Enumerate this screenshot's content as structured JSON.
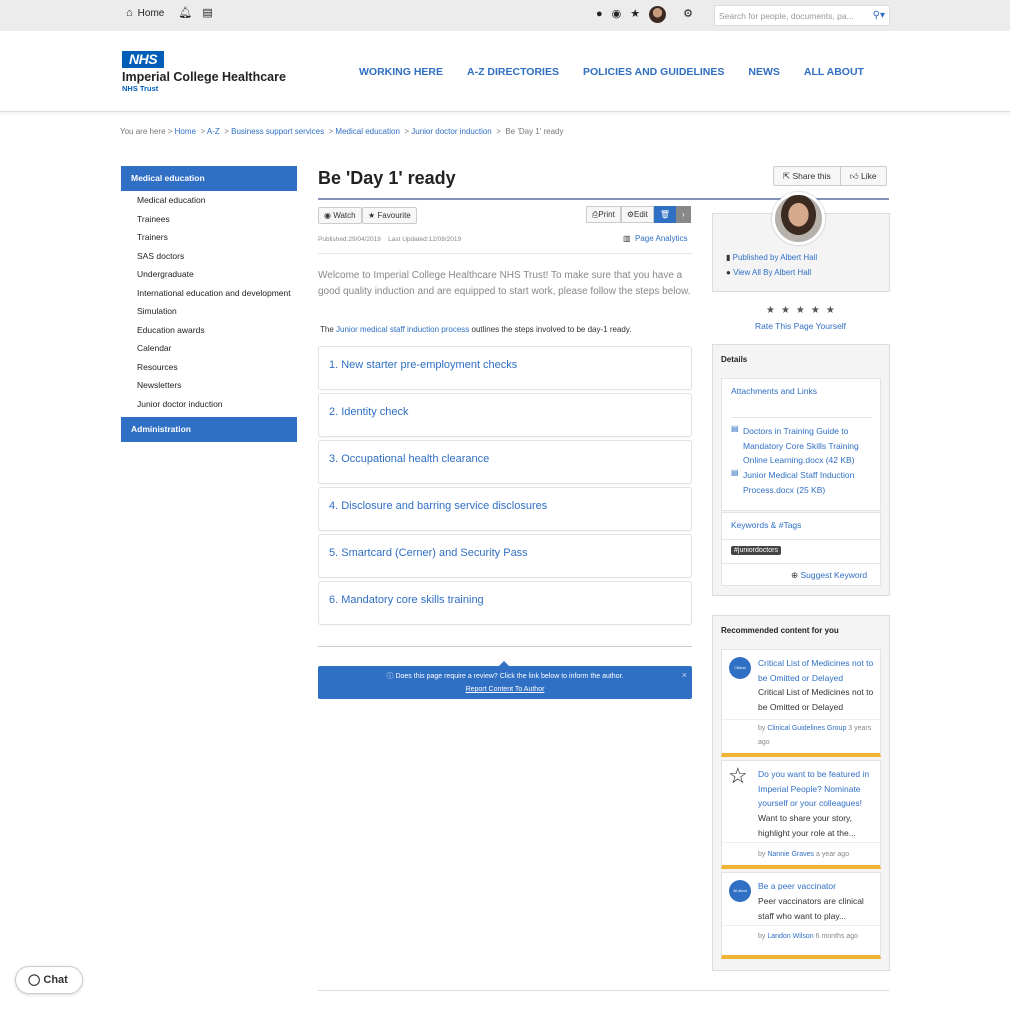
{
  "topbar": {
    "home_label": "Home",
    "search_placeholder": "Search for people, documents, pa...",
    "icons": [
      "home-icon",
      "bell-icon",
      "document-icon",
      "alert-icon",
      "eye-icon",
      "star-icon",
      "avatar",
      "gear-icon",
      "search-icon"
    ]
  },
  "header": {
    "logo": "NHS",
    "org_name": "Imperial College Healthcare",
    "trust": "NHS Trust",
    "nav": [
      "WORKING HERE",
      "A-Z DIRECTORIES",
      "POLICIES AND GUIDELINES",
      "NEWS",
      "ALL ABOUT"
    ]
  },
  "breadcrumb": {
    "prefix": "You are here >",
    "items": [
      "Home",
      "A-Z",
      "Business support services",
      "Medical education",
      "Junior doctor induction"
    ],
    "current": "Be 'Day 1' ready"
  },
  "sidebar": {
    "heading": "Medical education",
    "items": [
      "Medical education",
      "Trainees",
      "Trainers",
      "SAS doctors",
      "Undergraduate",
      "International education and development",
      "Simulation",
      "Education awards",
      "Calendar",
      "Resources",
      "Newsletters",
      "Junior doctor induction"
    ],
    "section2": "Administration"
  },
  "page": {
    "title": "Be 'Day 1' ready",
    "share_label": "Share this",
    "like_label": "Like",
    "watch_label": "Watch",
    "favourite_label": "Favourite",
    "print_label": "Print",
    "edit_label": "Edit",
    "published": "Published:29/04/2019",
    "updated": "Last Updated:12/08/2019",
    "analytics_label": "Page Analytics",
    "intro": "Welcome to Imperial College Healthcare NHS Trust! To make sure that you have a good quality induction and are equipped to start work, please follow the steps below.",
    "note_pre": "The",
    "note_link": "Junior medical staff induction process",
    "note_post": "outlines the steps involved to be day-1 ready.",
    "steps": [
      "1. New starter pre-employment checks",
      "2. Identity check",
      "3. Occupational health clearance",
      "4. Disclosure and barring service disclosures",
      "5. Smartcard (Cerner) and Security Pass",
      "6. Mandatory core skills training"
    ],
    "review_text": "Does this page require a review? Click the link below to inform the author.",
    "review_link": "Report Content To Author",
    "review_close": "×"
  },
  "publisher": {
    "published_by_pre": "Published by",
    "published_by": "Albert Hall",
    "view_all_pre": "View All By",
    "view_all": "Albert Hall",
    "stars": "★★★★★",
    "rate_label": "Rate This Page Yourself"
  },
  "details": {
    "heading": "Details",
    "attachments_heading": "Attachments and Links",
    "attachments": [
      "Doctors in Training Guide to Mandatory Core Skills Training Online Learning.docx (42 KB)",
      "Junior Medical Staff Induction Process.docx (25 KB)"
    ],
    "keywords_heading": "Keywords & #Tags",
    "tag": "#juniordoctors",
    "suggest_label": "Suggest Keyword"
  },
  "recommended": {
    "heading": "Recommended content for you",
    "items": [
      {
        "title": "Critical List of Medicines not to be Omitted or Delayed",
        "desc": "Critical List of Medicines not to be Omitted or Delayed",
        "by": "by",
        "author": "Clinical Guidelines Group",
        "time": "3 years ago",
        "badge": "Clinical guidelines"
      },
      {
        "title": "Do you want to be featured in Imperial People? Nominate yourself or your colleagues!",
        "desc": "Want to share your story, highlight your role at the...",
        "by": "by",
        "author": "Nannie Graves",
        "time": "a year ago",
        "badge": ""
      },
      {
        "title": "Be a peer vaccinator",
        "desc": "Peer vaccinators are clinical staff who want to play...",
        "by": "by",
        "author": "Landon Wilson",
        "time": "6 months ago",
        "badge": "All about"
      }
    ]
  },
  "chat": {
    "label": "Chat"
  }
}
